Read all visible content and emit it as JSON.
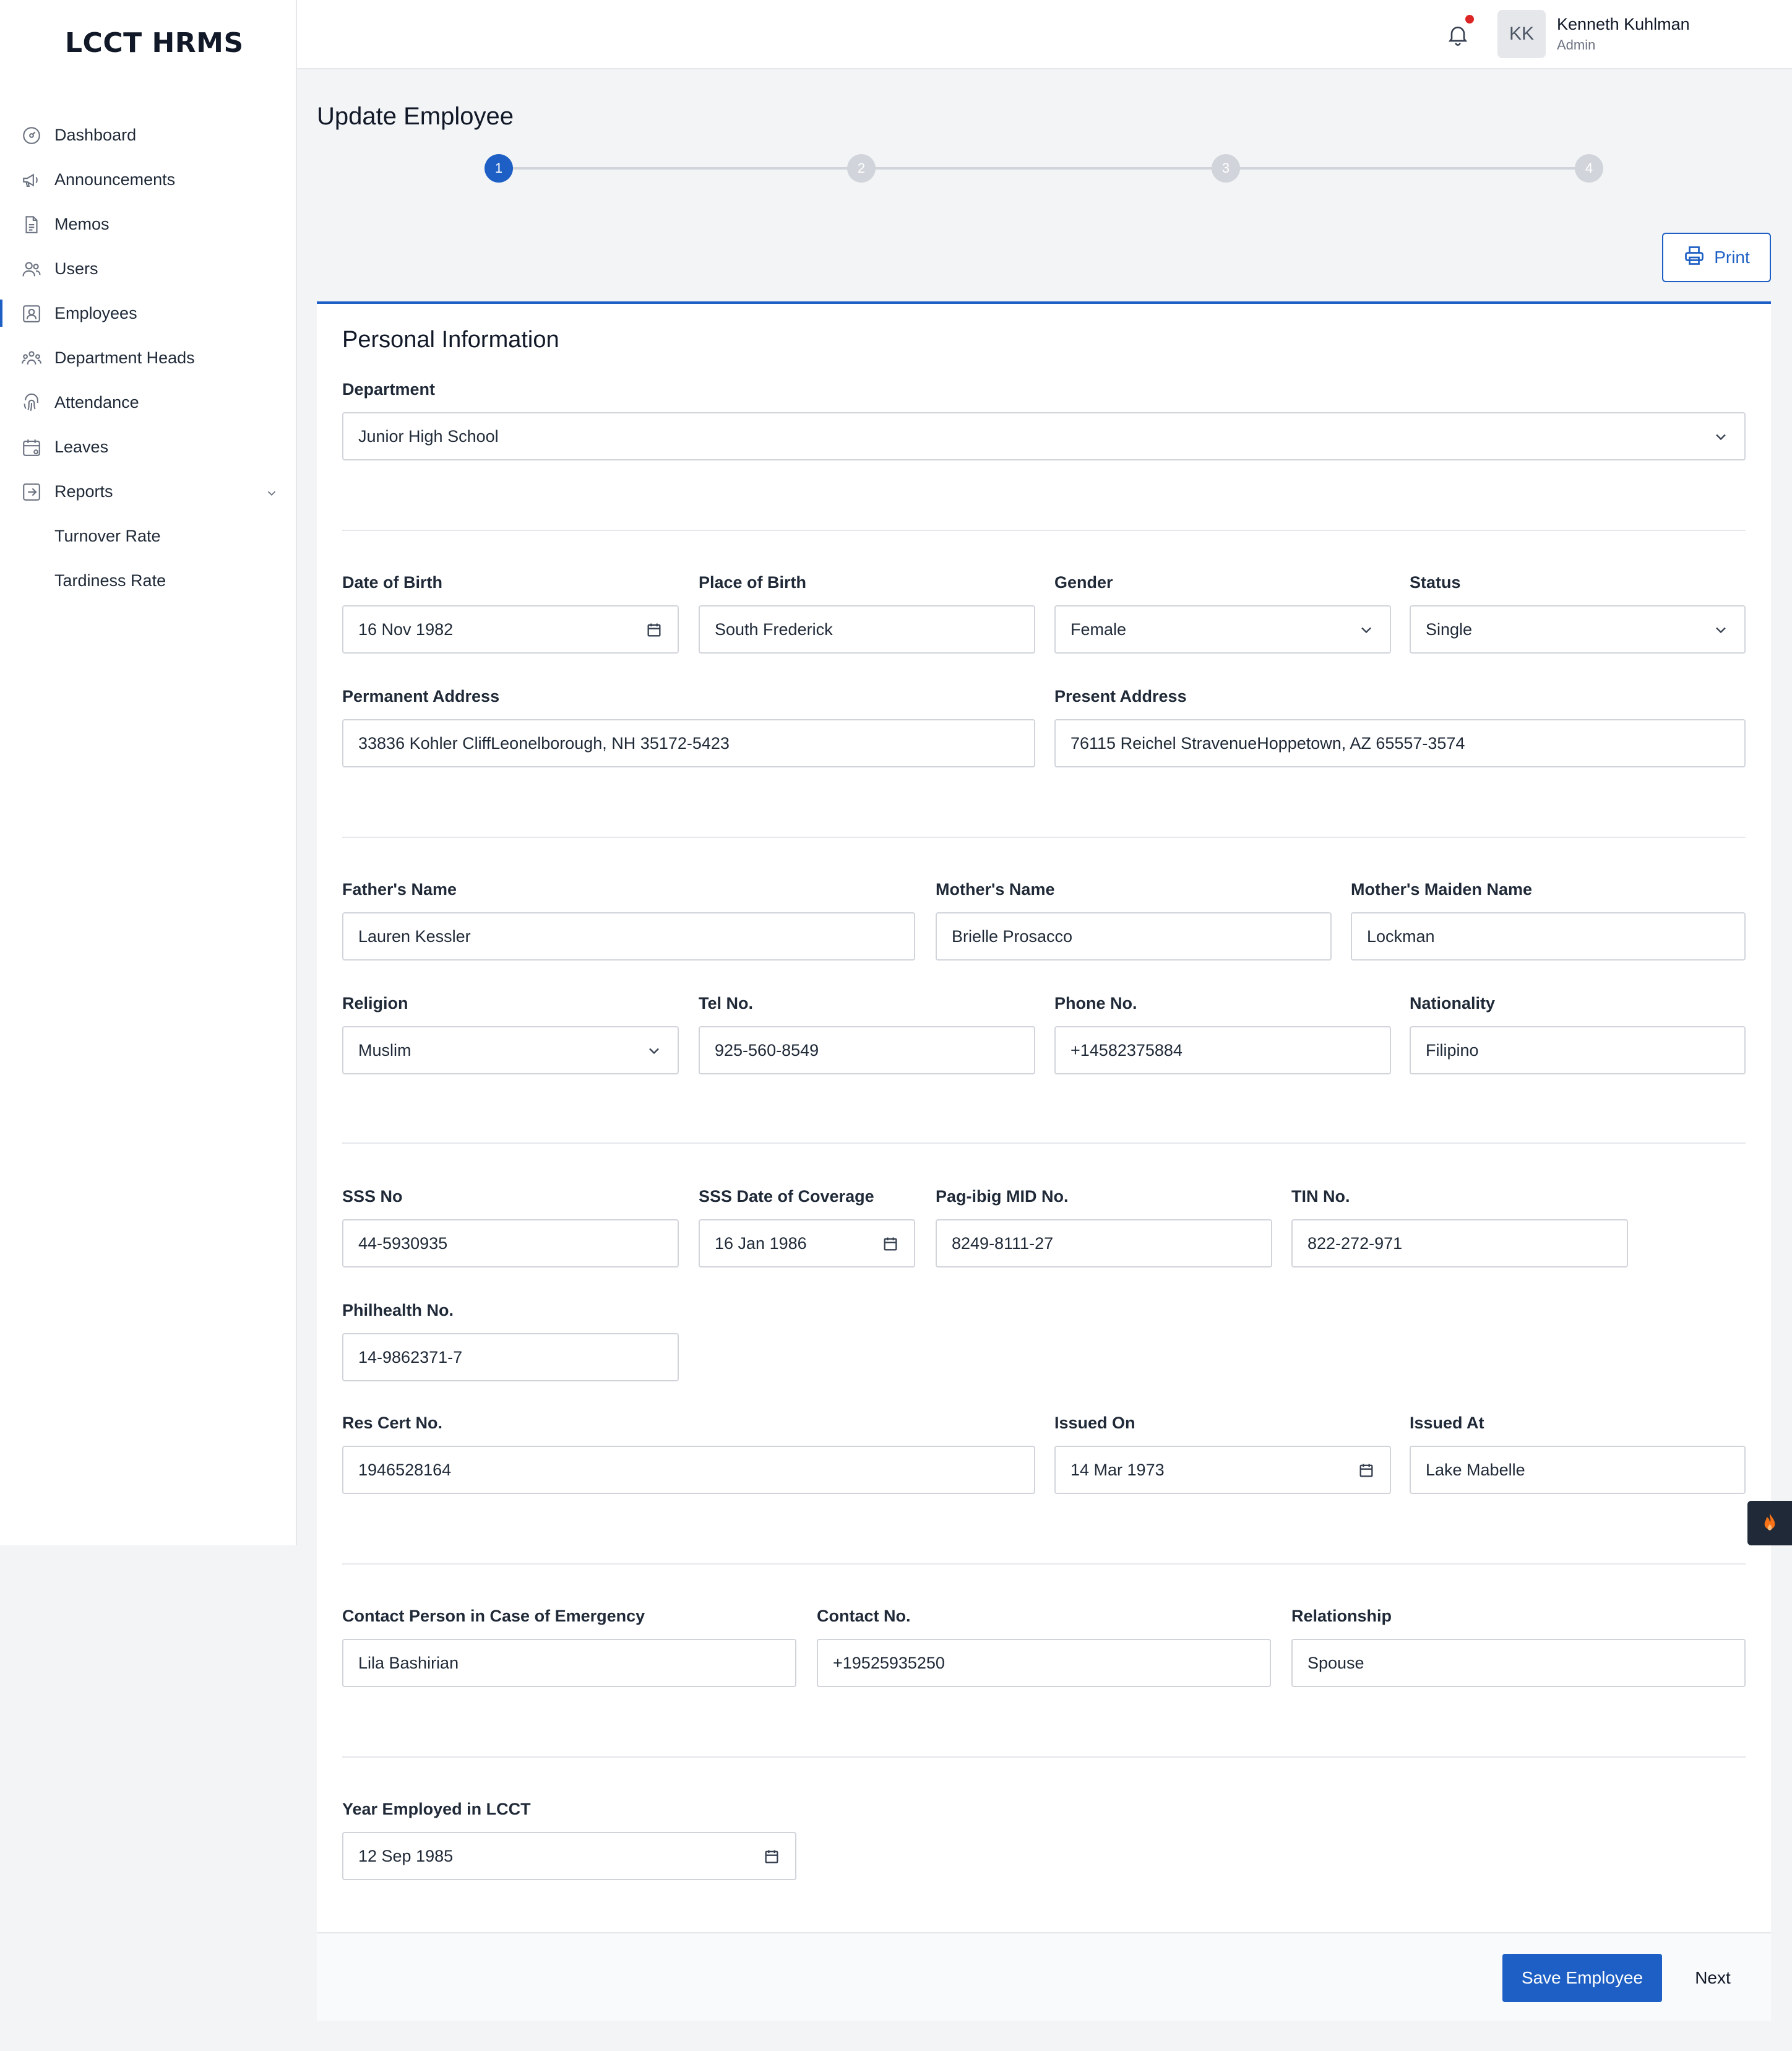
{
  "app": {
    "logo": "LCCT HRMS"
  },
  "sidebar": {
    "items": [
      {
        "label": "Dashboard",
        "icon": "dashboard-icon"
      },
      {
        "label": "Announcements",
        "icon": "megaphone-icon"
      },
      {
        "label": "Memos",
        "icon": "document-icon"
      },
      {
        "label": "Users",
        "icon": "users-icon"
      },
      {
        "label": "Employees",
        "icon": "employee-icon",
        "active": true
      },
      {
        "label": "Department Heads",
        "icon": "department-heads-icon"
      },
      {
        "label": "Attendance",
        "icon": "fingerprint-icon"
      },
      {
        "label": "Leaves",
        "icon": "calendar-icon"
      },
      {
        "label": "Reports",
        "icon": "report-icon",
        "expanded": true
      }
    ],
    "sub_items": [
      {
        "label": "Turnover Rate"
      },
      {
        "label": "Tardiness Rate"
      }
    ]
  },
  "header": {
    "user_initials": "KK",
    "user_name": "Kenneth Kuhlman",
    "user_role": "Admin",
    "has_notification": true
  },
  "page": {
    "title": "Update Employee",
    "steps": [
      "1",
      "2",
      "3",
      "4"
    ],
    "active_step": 1,
    "print_label": "Print"
  },
  "form": {
    "section_title": "Personal Information",
    "department": {
      "label": "Department",
      "value": "Junior High School"
    },
    "date_of_birth": {
      "label": "Date of Birth",
      "value": "16 Nov 1982"
    },
    "place_of_birth": {
      "label": "Place of Birth",
      "value": "South Frederick"
    },
    "gender": {
      "label": "Gender",
      "value": "Female"
    },
    "status": {
      "label": "Status",
      "value": "Single"
    },
    "permanent_address": {
      "label": "Permanent Address",
      "value": "33836 Kohler CliffLeonelborough, NH 35172-5423"
    },
    "present_address": {
      "label": "Present Address",
      "value": "76115 Reichel StravenueHoppetown, AZ 65557-3574"
    },
    "fathers_name": {
      "label": "Father's Name",
      "value": "Lauren Kessler"
    },
    "mothers_name": {
      "label": "Mother's Name",
      "value": "Brielle Prosacco"
    },
    "mothers_maiden_name": {
      "label": "Mother's Maiden Name",
      "value": "Lockman"
    },
    "religion": {
      "label": "Religion",
      "value": "Muslim"
    },
    "tel_no": {
      "label": "Tel No.",
      "value": "925-560-8549"
    },
    "phone_no": {
      "label": "Phone No.",
      "value": "+14582375884"
    },
    "nationality": {
      "label": "Nationality",
      "value": "Filipino"
    },
    "sss_no": {
      "label": "SSS No",
      "value": "44-5930935"
    },
    "sss_coverage": {
      "label": "SSS Date of Coverage",
      "value": "16 Jan 1986"
    },
    "pagibig_no": {
      "label": "Pag-ibig MID No.",
      "value": "8249-8111-27"
    },
    "tin_no": {
      "label": "TIN No.",
      "value": "822-272-971"
    },
    "philhealth_no": {
      "label": "Philhealth No.",
      "value": "14-9862371-7"
    },
    "res_cert_no": {
      "label": "Res Cert No.",
      "value": "1946528164"
    },
    "issued_on": {
      "label": "Issued On",
      "value": "14 Mar 1973"
    },
    "issued_at": {
      "label": "Issued At",
      "value": "Lake Mabelle"
    },
    "emergency_contact": {
      "label": "Contact Person in Case of Emergency",
      "value": "Lila Bashirian"
    },
    "contact_no": {
      "label": "Contact No.",
      "value": "+19525935250"
    },
    "relationship": {
      "label": "Relationship",
      "value": "Spouse"
    },
    "year_employed": {
      "label": "Year Employed in LCCT",
      "value": "12 Sep 1985"
    }
  },
  "footer": {
    "save_label": "Save Employee",
    "next_label": "Next"
  },
  "colors": {
    "accent": "#1d5fc4",
    "notification": "#dc2626"
  }
}
